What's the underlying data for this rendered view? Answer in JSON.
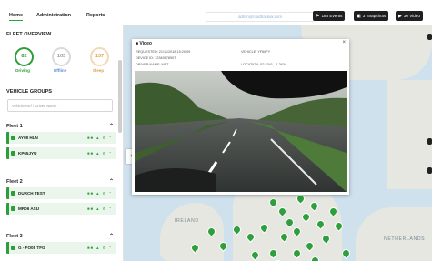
{
  "nav": {
    "items": [
      "Home",
      "Administration",
      "Reports"
    ],
    "active": 0
  },
  "user_email": "admin@roadtrackuk.com",
  "toolbar": {
    "events_label": "185 Events",
    "snapshots_label": "3 Snapshots",
    "videos_label": "30 Video"
  },
  "fleet_overview": {
    "title": "FLEET OVERVIEW",
    "stats": [
      {
        "value": "82",
        "label": "Driving",
        "color": "#2d9e3a"
      },
      {
        "value": "103",
        "label": "Offline",
        "color": "#5b8fd6"
      },
      {
        "value": "137",
        "label": "Sleep",
        "color": "#e0a24a"
      }
    ]
  },
  "vehicle_groups": {
    "title": "VEHICLE GROUPS",
    "search_placeholder": "Vehicle Ref / Driver Name"
  },
  "fleets": [
    {
      "name": "Fleet 1",
      "vehicles": [
        {
          "name": "AY08 HLN"
        },
        {
          "name": "KP65JYU"
        }
      ]
    },
    {
      "name": "Fleet 2",
      "vehicles": [
        {
          "name": "DURCH TEST"
        },
        {
          "name": "MR06 ASU"
        }
      ]
    },
    {
      "name": "Fleet 3",
      "vehicles": [
        {
          "name": "G - FO08 TFG"
        }
      ]
    }
  ],
  "video_popup": {
    "title": "Video",
    "requested": "REQUESTED: 21/11/2018 15:20:09",
    "vehicle": "VEHICLE: YF66FY",
    "device_id": "DEVICE ID: 1234567890T",
    "location": "LOCATION: 52.2341, -1.2634",
    "driver_name": "DRIVER NAME: MST"
  },
  "map": {
    "label_ireland": "IRELAND",
    "label_netherlands": "NETHERLANDS"
  },
  "colors": {
    "accent": "#2d9e3a",
    "pin": "#2f9e3c",
    "sea": "#cfe1ed",
    "land": "#e6e7e1"
  }
}
